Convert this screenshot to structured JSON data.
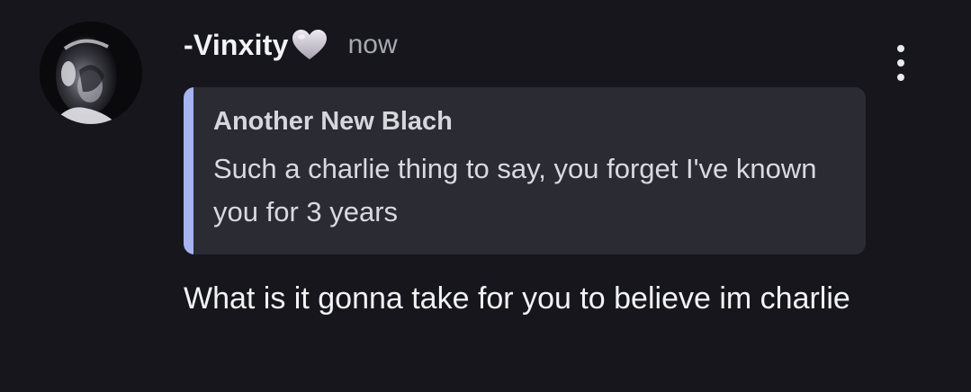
{
  "message": {
    "author": "-Vinxity",
    "author_badge_icon": "heart-icon",
    "author_badge_color": "#c9c4cf",
    "timestamp": "now",
    "reply": {
      "author": "Another New Blach",
      "text": "Such a charlie thing to say, you forget I've known you for 3 years",
      "accent_color": "#a8b3f2"
    },
    "body": "What is it gonna take for you to believe im charlie",
    "more_icon": "more-vertical-icon"
  },
  "colors": {
    "background": "#16161c",
    "reply_background": "#2b2b33",
    "text_primary": "#f2f3f5",
    "text_muted": "#a7a9b0"
  }
}
